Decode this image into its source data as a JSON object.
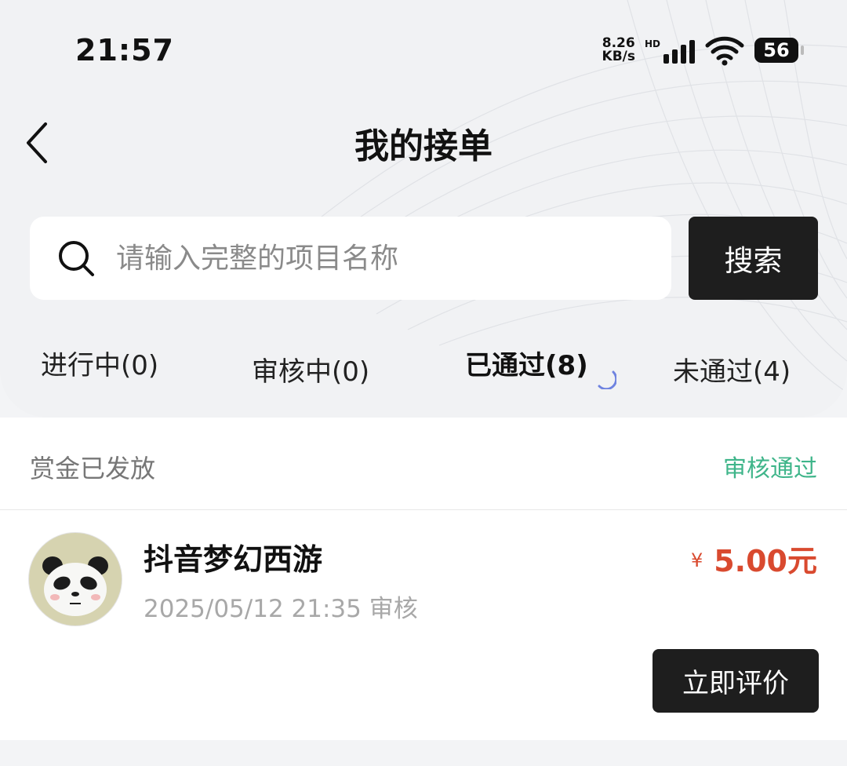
{
  "status_bar": {
    "time": "21:57",
    "net_speed_value": "8.26",
    "net_speed_unit": "KB/s",
    "hd_label": "HD",
    "battery": "56"
  },
  "header": {
    "title": "我的接单",
    "back_icon": "chevron-left-icon"
  },
  "search": {
    "placeholder": "请输入完整的项目名称",
    "value": "",
    "button_label": "搜索",
    "icon": "search-icon"
  },
  "tabs": [
    {
      "label": "进行中(0)",
      "active": false
    },
    {
      "label": "审核中(0)",
      "active": false
    },
    {
      "label": "已通过(8)",
      "active": true
    },
    {
      "label": "未通过(4)",
      "active": false
    }
  ],
  "section": {
    "left": "赏金已发放",
    "right": "审核通过"
  },
  "order": {
    "title": "抖音梦幻西游",
    "meta": "2025/05/12 21:35 审核",
    "currency_symbol": "¥",
    "amount": "5.00元",
    "action_label": "立即评价",
    "avatar": "panda-avatar"
  },
  "colors": {
    "accent_dark": "#1e1e1e",
    "success": "#3fb58a",
    "price": "#d94a2f",
    "spinner": "#6f83e0"
  }
}
